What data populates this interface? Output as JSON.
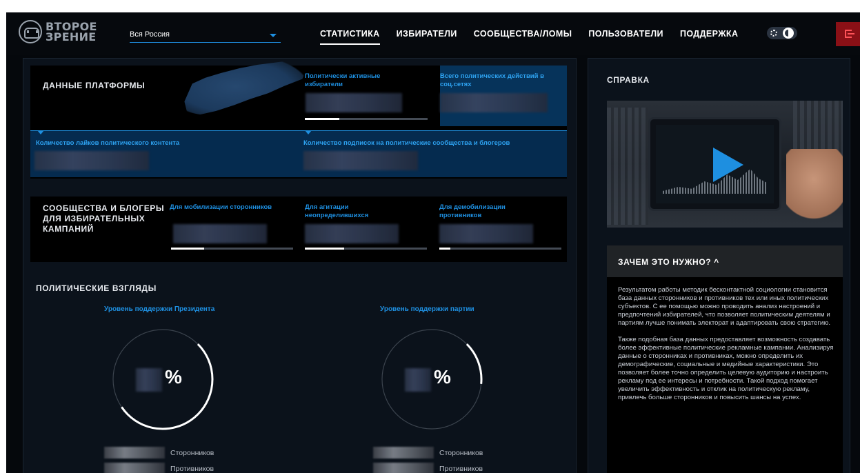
{
  "header": {
    "logo_line1": "ВТОРОЕ",
    "logo_line2": "ЗРЕНИЕ",
    "region": "Вся Россия",
    "nav": [
      "СТАТИСТИКА",
      "ИЗБИРАТЕЛИ",
      "СООБЩЕСТВА/ЛОМЫ",
      "ПОЛЬЗОВАТЕЛИ",
      "ПОДДЕРЖКА"
    ],
    "active_nav": "СТАТИСТИКА"
  },
  "platform": {
    "title": "ДАННЫЕ ПЛАТФОРМЫ",
    "active_voters": "Политически активные избиратели",
    "active_voters_progress": 0.28,
    "total_actions": "Всего политических действий в соц.сетях",
    "likes": "Количество лайков политического контента",
    "subscriptions": "Количество подписок на политические сообщества и блогеров"
  },
  "communities": {
    "title": "СООБЩЕСТВА И БЛОГЕРЫ ДЛЯ ИЗБИРАТЕЛЬНЫХ КАМПАНИЙ",
    "items": [
      {
        "label": "Для мобилизации сторонников",
        "progress": 0.27
      },
      {
        "label": "Для агитации неопределившихся",
        "progress": 0.32
      },
      {
        "label": "Для демобилизации противников",
        "progress": 0.09
      }
    ]
  },
  "views": {
    "title": "ПОЛИТИЧЕСКИЕ ВЗГЛЯДЫ",
    "gauges": [
      {
        "label": "Уровень поддержки Президента",
        "symbol": "%",
        "fill": 0.53
      },
      {
        "label": "Уровень поддержки партии",
        "symbol": "%",
        "fill": 0.14
      }
    ],
    "legend": [
      "Сторонников",
      "Противников"
    ]
  },
  "side": {
    "title": "СПРАВКА",
    "why_title": "ЗАЧЕМ ЭТО НУЖНО? ^",
    "paragraph1": "Результатом работы методик бесконтактной социологии становится база данных сторонников и противников тех или иных политических субъектов. С ее помощью можно проводить анализ настроений и предпочтений избирателей, что позволяет политическим деятелям и партиям лучше понимать электорат и адаптировать свою стратегию.",
    "paragraph2": "Также подобная база данных предоставляет возможность создавать более эффективные политические рекламные кампании. Анализируя данные о сторонниках и противниках, можно определить их демографические, социальные и медийные характеристики. Это позволяет более точно определить целевую аудиторию и настроить рекламу под ее интересы и потребности. Такой подход помогает увеличить эффективность и отклик на политическую рекламу, привлечь больше сторонников и повысить шансы на успех."
  },
  "colors": {
    "accent": "#1e8fe0",
    "background": "#05080c",
    "panel": "#0b121b",
    "logout": "#8a1016"
  }
}
